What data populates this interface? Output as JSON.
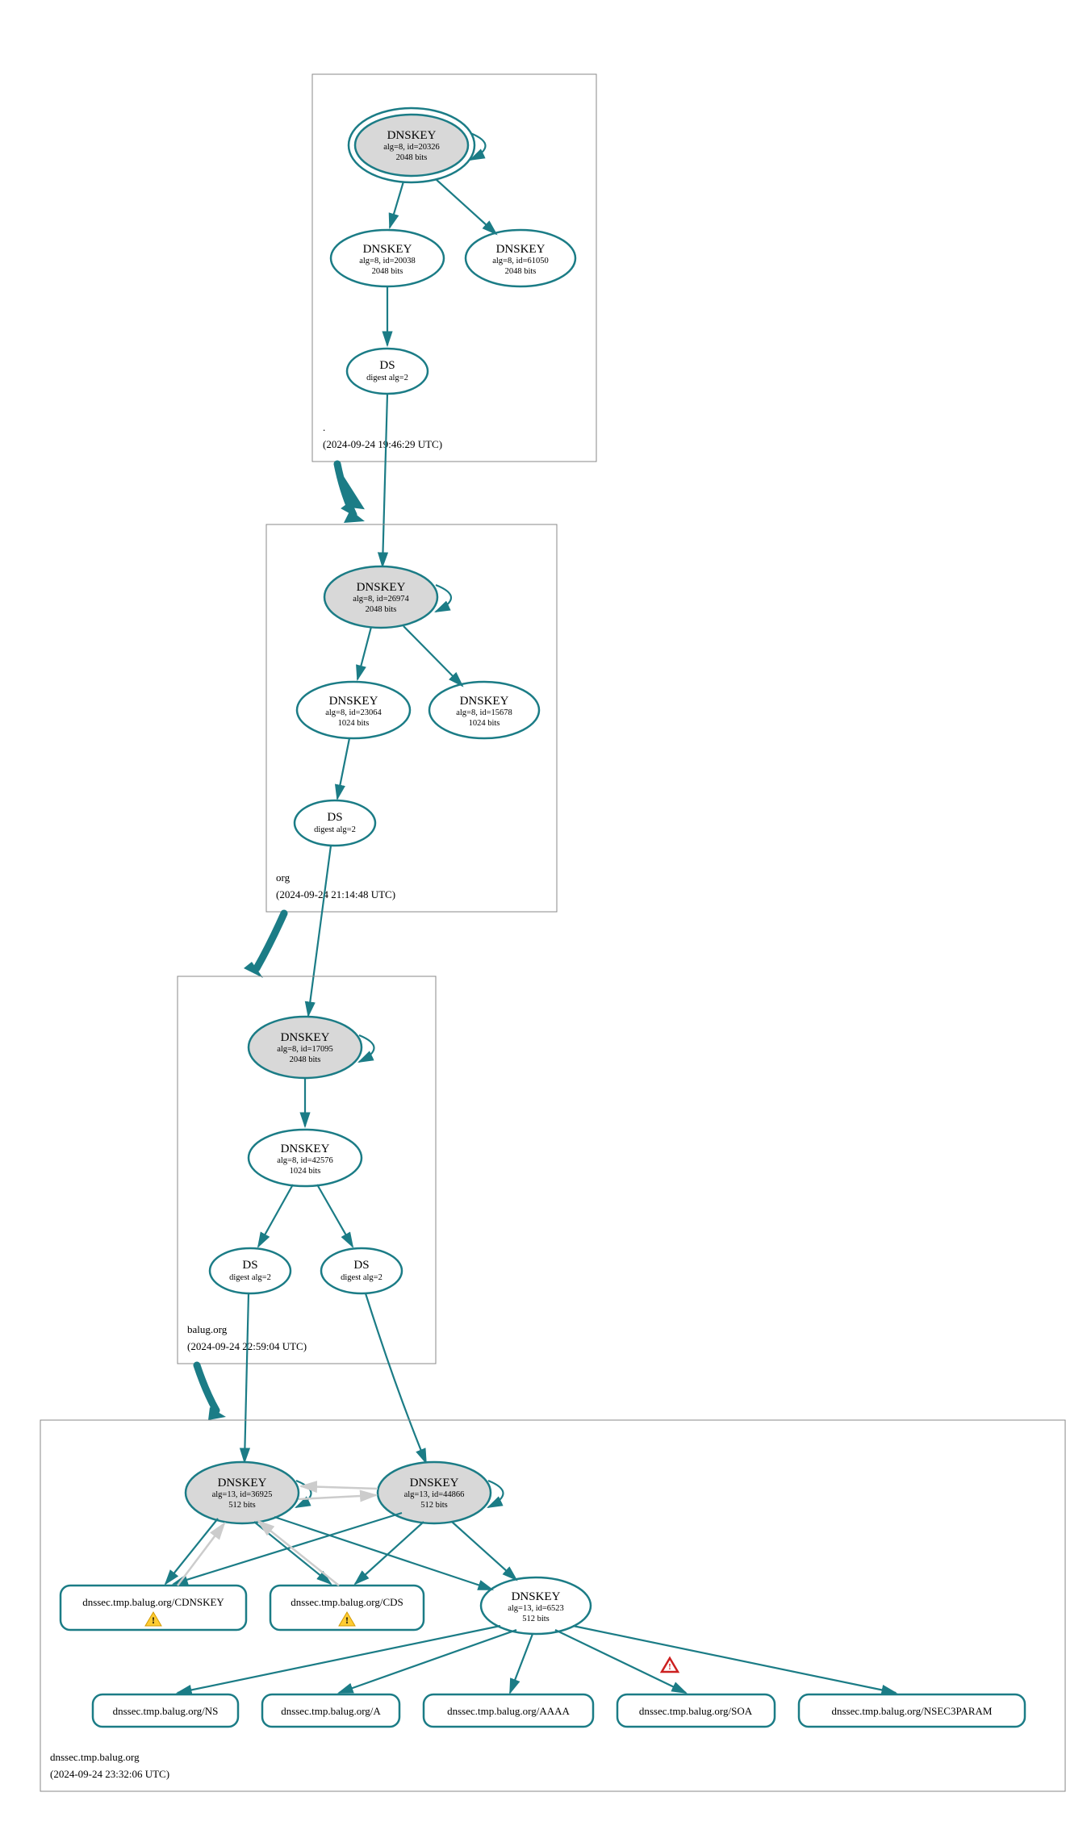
{
  "zones": {
    "root": {
      "name": ".",
      "timestamp": "(2024-09-24 19:46:29 UTC)"
    },
    "org": {
      "name": "org",
      "timestamp": "(2024-09-24 21:14:48 UTC)"
    },
    "balug": {
      "name": "balug.org",
      "timestamp": "(2024-09-24 22:59:04 UTC)"
    },
    "dnssec": {
      "name": "dnssec.tmp.balug.org",
      "timestamp": "(2024-09-24 23:32:06 UTC)"
    }
  },
  "nodes": {
    "root_ksk": {
      "title": "DNSKEY",
      "line2": "alg=8, id=20326",
      "line3": "2048 bits"
    },
    "root_zsk1": {
      "title": "DNSKEY",
      "line2": "alg=8, id=20038",
      "line3": "2048 bits"
    },
    "root_zsk2": {
      "title": "DNSKEY",
      "line2": "alg=8, id=61050",
      "line3": "2048 bits"
    },
    "root_ds": {
      "title": "DS",
      "line2": "digest alg=2"
    },
    "org_ksk": {
      "title": "DNSKEY",
      "line2": "alg=8, id=26974",
      "line3": "2048 bits"
    },
    "org_zsk1": {
      "title": "DNSKEY",
      "line2": "alg=8, id=23064",
      "line3": "1024 bits"
    },
    "org_zsk2": {
      "title": "DNSKEY",
      "line2": "alg=8, id=15678",
      "line3": "1024 bits"
    },
    "org_ds": {
      "title": "DS",
      "line2": "digest alg=2"
    },
    "balug_ksk": {
      "title": "DNSKEY",
      "line2": "alg=8, id=17095",
      "line3": "2048 bits"
    },
    "balug_zsk": {
      "title": "DNSKEY",
      "line2": "alg=8, id=42576",
      "line3": "1024 bits"
    },
    "balug_ds1": {
      "title": "DS",
      "line2": "digest alg=2"
    },
    "balug_ds2": {
      "title": "DS",
      "line2": "digest alg=2"
    },
    "dnssec_ksk1": {
      "title": "DNSKEY",
      "line2": "alg=13, id=36925",
      "line3": "512 bits"
    },
    "dnssec_ksk2": {
      "title": "DNSKEY",
      "line2": "alg=13, id=44866",
      "line3": "512 bits"
    },
    "dnssec_zsk": {
      "title": "DNSKEY",
      "line2": "alg=13, id=6523",
      "line3": "512 bits"
    },
    "cdnskey": {
      "label": "dnssec.tmp.balug.org/CDNSKEY"
    },
    "cds": {
      "label": "dnssec.tmp.balug.org/CDS"
    },
    "ns": {
      "label": "dnssec.tmp.balug.org/NS"
    },
    "a": {
      "label": "dnssec.tmp.balug.org/A"
    },
    "aaaa": {
      "label": "dnssec.tmp.balug.org/AAAA"
    },
    "soa": {
      "label": "dnssec.tmp.balug.org/SOA"
    },
    "nsec3param": {
      "label": "dnssec.tmp.balug.org/NSEC3PARAM"
    }
  }
}
